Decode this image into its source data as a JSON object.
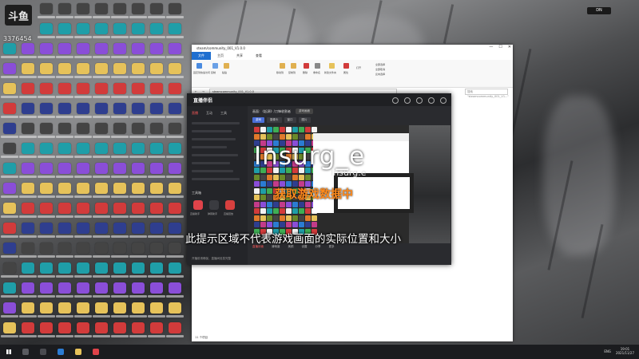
{
  "overlay": {
    "title": "Insurg_e",
    "subtitle": "Insurg.e",
    "orange_text": "获取游戏数据中",
    "caption": "此提示区域不代表游戏画面的实际位置和大小"
  },
  "desktop": {
    "logo": "斗鱼",
    "user_id": "3376454",
    "chip_label": "DN"
  },
  "explorer": {
    "title": "steam/community_001_V1.0.0",
    "tabs": [
      "文件",
      "主页",
      "共享",
      "查看"
    ],
    "active_tab": "文件",
    "address": "steamcommunity_001_V1.0.0",
    "search_placeholder": "搜索 \"steamcommunity_001_V1...\"",
    "status": "11 个项目",
    "ribbon": [
      "固定到快速访问",
      "复制",
      "粘贴",
      "移动到",
      "复制到",
      "删除",
      "重命名",
      "新建文件夹",
      "属性",
      "打开",
      "全部选择",
      "全部取消",
      "反向选择"
    ]
  },
  "recorder": {
    "brand": "直播伴侣",
    "menu": [
      "直播",
      "互动",
      "工具"
    ],
    "toolbox_label": "工具箱",
    "tools": [
      "直播助手",
      "弹幕助手",
      "直播回放",
      "分享"
    ],
    "game_title": "画面: 《起源》/刀锋收割者",
    "game_pill": "游戏画面",
    "source_tabs": [
      "游戏",
      "摄像头",
      "窗口",
      "图片"
    ],
    "bottom_items": [
      "直播封面",
      "清晰度",
      "美颜",
      "设置",
      "分享",
      "更多"
    ],
    "footer": "开播前请确保，直播间信息完整"
  },
  "taskbar": {
    "lang": "ENG",
    "time": "19:01",
    "date": "2021/11/27"
  }
}
